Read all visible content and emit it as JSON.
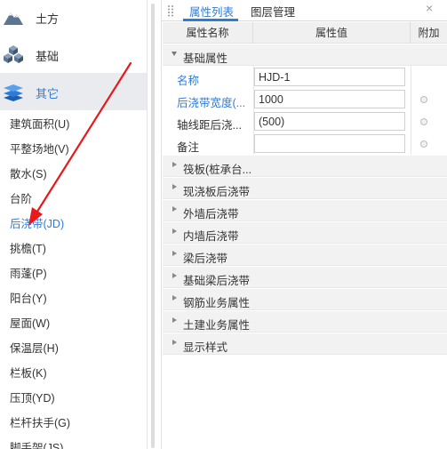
{
  "categories": [
    {
      "label": "土方",
      "icon": "mountain-icon"
    },
    {
      "label": "基础",
      "icon": "cubes-icon"
    },
    {
      "label": "其它",
      "icon": "layers-icon",
      "active": true
    }
  ],
  "items": [
    {
      "label": "建筑面积(U)"
    },
    {
      "label": "平整场地(V)"
    },
    {
      "label": "散水(S)"
    },
    {
      "label": "台阶"
    },
    {
      "label": "后浇带(JD)",
      "selected": true
    },
    {
      "label": "挑檐(T)"
    },
    {
      "label": "雨蓬(P)"
    },
    {
      "label": "阳台(Y)"
    },
    {
      "label": "屋面(W)"
    },
    {
      "label": "保温层(H)"
    },
    {
      "label": "栏板(K)"
    },
    {
      "label": "压顶(YD)"
    },
    {
      "label": "栏杆扶手(G)"
    },
    {
      "label": "脚手架(JS)"
    }
  ],
  "tabs": [
    {
      "label": "属性列表",
      "active": true
    },
    {
      "label": "图层管理"
    }
  ],
  "close_glyph": "×",
  "table_header": {
    "name": "属性名称",
    "value": "属性值",
    "extra": "附加"
  },
  "groups": {
    "basic": {
      "label": "基础属性"
    },
    "rest": [
      {
        "label": "筏板(桩承台..."
      },
      {
        "label": "现浇板后浇带"
      },
      {
        "label": "外墙后浇带"
      },
      {
        "label": "内墙后浇带"
      },
      {
        "label": "梁后浇带"
      },
      {
        "label": "基础梁后浇带"
      },
      {
        "label": "钢筋业务属性"
      },
      {
        "label": "土建业务属性"
      },
      {
        "label": "显示样式"
      }
    ]
  },
  "properties": [
    {
      "name": "名称",
      "value": "HJD-1",
      "blue": true,
      "radio": false
    },
    {
      "name": "后浇带宽度(...",
      "value": "1000",
      "blue": true,
      "radio": true
    },
    {
      "name": "轴线距后浇...",
      "value": "(500)",
      "blue": false,
      "radio": true
    },
    {
      "name": "备注",
      "value": "",
      "blue": false,
      "radio": true
    }
  ],
  "colors": {
    "accent": "#2f7bd8",
    "arrow": "#e8191c"
  }
}
